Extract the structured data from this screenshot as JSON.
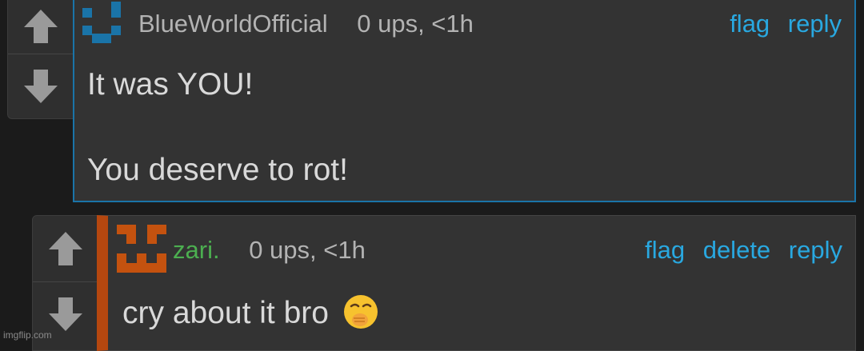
{
  "comments": [
    {
      "author": "BlueWorldOfficial",
      "ups": "0 ups, <1h",
      "actions": [
        "flag",
        "reply"
      ],
      "lines": [
        "It was YOU!",
        "You deserve to rot!"
      ],
      "avatar_color": "#1a74a8",
      "border_color": "#1a74a8",
      "author_color": "#b3b3b3"
    },
    {
      "author": "zari.",
      "ups": "0 ups, <1h",
      "actions": [
        "flag",
        "delete",
        "reply"
      ],
      "lines": [
        "cry about it bro"
      ],
      "emoji_icon": "hand-over-mouth-emoji-icon",
      "avatar_color": "#c4520f",
      "border_color": "#b5470f",
      "author_color": "#4caf50"
    }
  ],
  "watermark": "imgflip.com",
  "colors": {
    "link": "#29a8e0",
    "background": "#1b1b1b",
    "panel": "#333333"
  }
}
